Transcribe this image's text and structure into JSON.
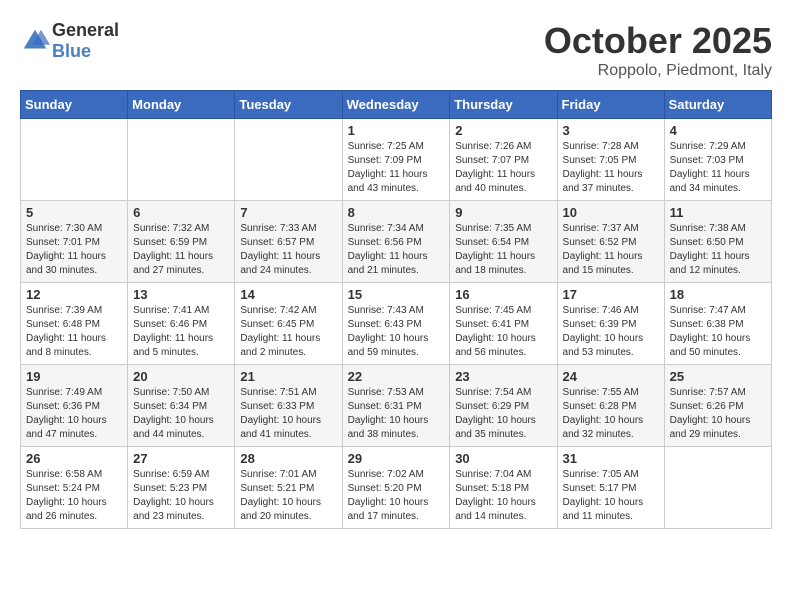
{
  "header": {
    "logo_general": "General",
    "logo_blue": "Blue",
    "month": "October 2025",
    "location": "Roppolo, Piedmont, Italy"
  },
  "days_of_week": [
    "Sunday",
    "Monday",
    "Tuesday",
    "Wednesday",
    "Thursday",
    "Friday",
    "Saturday"
  ],
  "weeks": [
    [
      {
        "day": "",
        "content": ""
      },
      {
        "day": "",
        "content": ""
      },
      {
        "day": "",
        "content": ""
      },
      {
        "day": "1",
        "content": "Sunrise: 7:25 AM\nSunset: 7:09 PM\nDaylight: 11 hours\nand 43 minutes."
      },
      {
        "day": "2",
        "content": "Sunrise: 7:26 AM\nSunset: 7:07 PM\nDaylight: 11 hours\nand 40 minutes."
      },
      {
        "day": "3",
        "content": "Sunrise: 7:28 AM\nSunset: 7:05 PM\nDaylight: 11 hours\nand 37 minutes."
      },
      {
        "day": "4",
        "content": "Sunrise: 7:29 AM\nSunset: 7:03 PM\nDaylight: 11 hours\nand 34 minutes."
      }
    ],
    [
      {
        "day": "5",
        "content": "Sunrise: 7:30 AM\nSunset: 7:01 PM\nDaylight: 11 hours\nand 30 minutes."
      },
      {
        "day": "6",
        "content": "Sunrise: 7:32 AM\nSunset: 6:59 PM\nDaylight: 11 hours\nand 27 minutes."
      },
      {
        "day": "7",
        "content": "Sunrise: 7:33 AM\nSunset: 6:57 PM\nDaylight: 11 hours\nand 24 minutes."
      },
      {
        "day": "8",
        "content": "Sunrise: 7:34 AM\nSunset: 6:56 PM\nDaylight: 11 hours\nand 21 minutes."
      },
      {
        "day": "9",
        "content": "Sunrise: 7:35 AM\nSunset: 6:54 PM\nDaylight: 11 hours\nand 18 minutes."
      },
      {
        "day": "10",
        "content": "Sunrise: 7:37 AM\nSunset: 6:52 PM\nDaylight: 11 hours\nand 15 minutes."
      },
      {
        "day": "11",
        "content": "Sunrise: 7:38 AM\nSunset: 6:50 PM\nDaylight: 11 hours\nand 12 minutes."
      }
    ],
    [
      {
        "day": "12",
        "content": "Sunrise: 7:39 AM\nSunset: 6:48 PM\nDaylight: 11 hours\nand 8 minutes."
      },
      {
        "day": "13",
        "content": "Sunrise: 7:41 AM\nSunset: 6:46 PM\nDaylight: 11 hours\nand 5 minutes."
      },
      {
        "day": "14",
        "content": "Sunrise: 7:42 AM\nSunset: 6:45 PM\nDaylight: 11 hours\nand 2 minutes."
      },
      {
        "day": "15",
        "content": "Sunrise: 7:43 AM\nSunset: 6:43 PM\nDaylight: 10 hours\nand 59 minutes."
      },
      {
        "day": "16",
        "content": "Sunrise: 7:45 AM\nSunset: 6:41 PM\nDaylight: 10 hours\nand 56 minutes."
      },
      {
        "day": "17",
        "content": "Sunrise: 7:46 AM\nSunset: 6:39 PM\nDaylight: 10 hours\nand 53 minutes."
      },
      {
        "day": "18",
        "content": "Sunrise: 7:47 AM\nSunset: 6:38 PM\nDaylight: 10 hours\nand 50 minutes."
      }
    ],
    [
      {
        "day": "19",
        "content": "Sunrise: 7:49 AM\nSunset: 6:36 PM\nDaylight: 10 hours\nand 47 minutes."
      },
      {
        "day": "20",
        "content": "Sunrise: 7:50 AM\nSunset: 6:34 PM\nDaylight: 10 hours\nand 44 minutes."
      },
      {
        "day": "21",
        "content": "Sunrise: 7:51 AM\nSunset: 6:33 PM\nDaylight: 10 hours\nand 41 minutes."
      },
      {
        "day": "22",
        "content": "Sunrise: 7:53 AM\nSunset: 6:31 PM\nDaylight: 10 hours\nand 38 minutes."
      },
      {
        "day": "23",
        "content": "Sunrise: 7:54 AM\nSunset: 6:29 PM\nDaylight: 10 hours\nand 35 minutes."
      },
      {
        "day": "24",
        "content": "Sunrise: 7:55 AM\nSunset: 6:28 PM\nDaylight: 10 hours\nand 32 minutes."
      },
      {
        "day": "25",
        "content": "Sunrise: 7:57 AM\nSunset: 6:26 PM\nDaylight: 10 hours\nand 29 minutes."
      }
    ],
    [
      {
        "day": "26",
        "content": "Sunrise: 6:58 AM\nSunset: 5:24 PM\nDaylight: 10 hours\nand 26 minutes."
      },
      {
        "day": "27",
        "content": "Sunrise: 6:59 AM\nSunset: 5:23 PM\nDaylight: 10 hours\nand 23 minutes."
      },
      {
        "day": "28",
        "content": "Sunrise: 7:01 AM\nSunset: 5:21 PM\nDaylight: 10 hours\nand 20 minutes."
      },
      {
        "day": "29",
        "content": "Sunrise: 7:02 AM\nSunset: 5:20 PM\nDaylight: 10 hours\nand 17 minutes."
      },
      {
        "day": "30",
        "content": "Sunrise: 7:04 AM\nSunset: 5:18 PM\nDaylight: 10 hours\nand 14 minutes."
      },
      {
        "day": "31",
        "content": "Sunrise: 7:05 AM\nSunset: 5:17 PM\nDaylight: 10 hours\nand 11 minutes."
      },
      {
        "day": "",
        "content": ""
      }
    ]
  ]
}
